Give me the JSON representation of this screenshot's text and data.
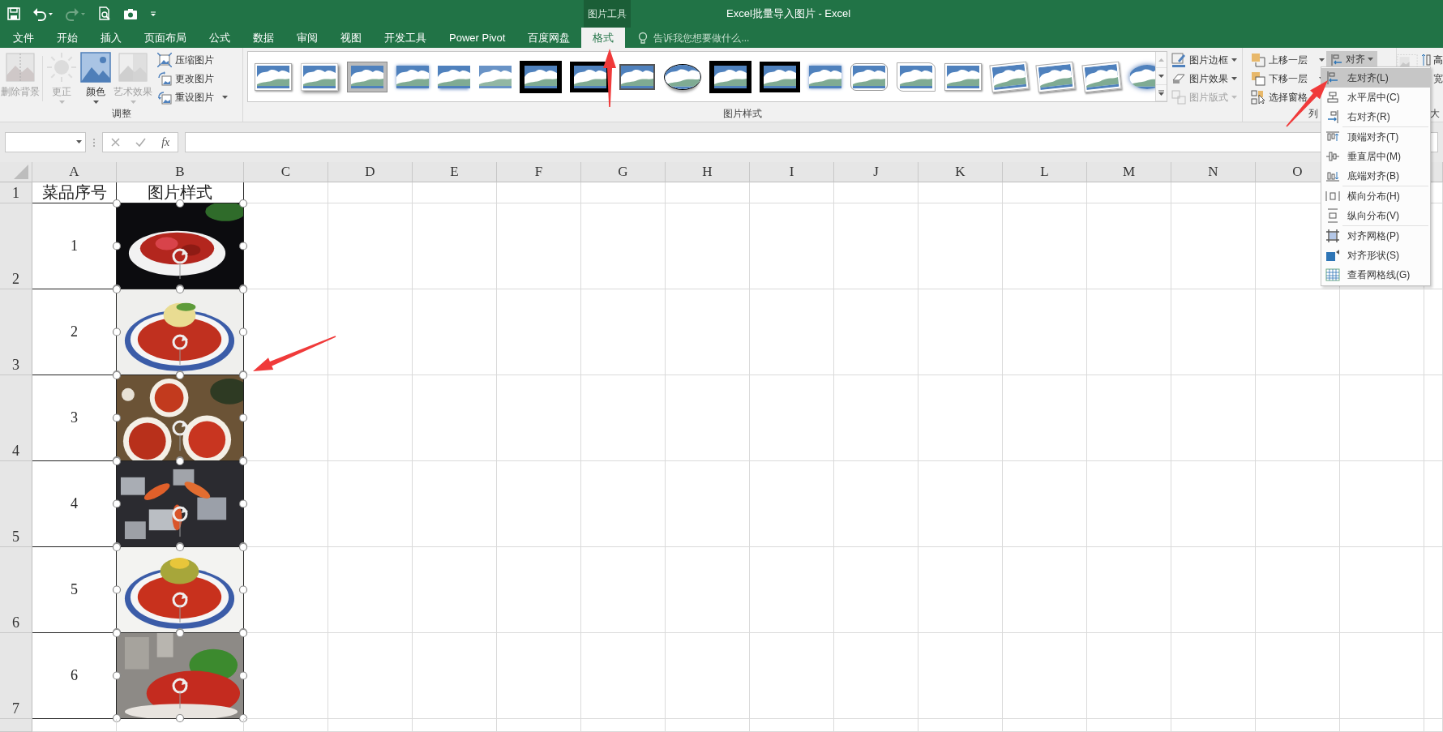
{
  "quick_access": [
    {
      "kind": "save",
      "disabled": false
    },
    {
      "kind": "undo",
      "disabled": false
    },
    {
      "kind": "redo",
      "disabled": true
    },
    {
      "kind": "print-preview",
      "disabled": false
    },
    {
      "kind": "camera",
      "disabled": false
    },
    {
      "kind": "customize",
      "disabled": false
    }
  ],
  "window": {
    "title": "Excel批量导入图片 - Excel",
    "context_label": "图片工具"
  },
  "tabs": [
    {
      "label": "文件",
      "selected": false
    },
    {
      "label": "开始",
      "selected": false
    },
    {
      "label": "插入",
      "selected": false
    },
    {
      "label": "页面布局",
      "selected": false
    },
    {
      "label": "公式",
      "selected": false
    },
    {
      "label": "数据",
      "selected": false
    },
    {
      "label": "审阅",
      "selected": false
    },
    {
      "label": "视图",
      "selected": false
    },
    {
      "label": "开发工具",
      "selected": false
    },
    {
      "label": "Power Pivot",
      "selected": false
    },
    {
      "label": "百度网盘",
      "selected": false
    },
    {
      "label": "格式",
      "selected": true
    }
  ],
  "tell_me": {
    "placeholder": "告诉我您想要做什么..."
  },
  "ribbon": {
    "adjust": {
      "label": "调整",
      "large_buttons": [
        {
          "label": "删除背景",
          "kind": "remove-background",
          "disabled": true,
          "dropdown": false
        },
        {
          "label": "更正",
          "kind": "corrections",
          "disabled": true,
          "dropdown": true
        },
        {
          "label": "颜色",
          "kind": "color",
          "disabled": false,
          "dropdown": true
        },
        {
          "label": "艺术效果",
          "kind": "artistic",
          "disabled": true,
          "dropdown": true
        }
      ],
      "small_buttons": [
        {
          "label": "压缩图片",
          "kind": "compress",
          "dropdown": false
        },
        {
          "label": "更改图片",
          "kind": "change",
          "dropdown": false
        },
        {
          "label": "重设图片",
          "kind": "reset",
          "dropdown": true
        }
      ]
    },
    "styles": {
      "label": "图片样式",
      "gallery": [
        {
          "kind": "frame"
        },
        {
          "kind": "shadow"
        },
        {
          "kind": "matte"
        },
        {
          "kind": "soft"
        },
        {
          "kind": "reflect"
        },
        {
          "kind": "fade"
        },
        {
          "kind": "double"
        },
        {
          "kind": "thick"
        },
        {
          "kind": "bevel"
        },
        {
          "kind": "oval"
        },
        {
          "kind": "double"
        },
        {
          "kind": "thick"
        },
        {
          "kind": "soft"
        },
        {
          "kind": "rounded"
        },
        {
          "kind": "snip"
        },
        {
          "kind": "frame"
        },
        {
          "kind": "tilt"
        },
        {
          "kind": "tilt"
        },
        {
          "kind": "tilt"
        },
        {
          "kind": "oval-soft"
        }
      ],
      "buttons": [
        {
          "label": "图片边框",
          "kind": "border",
          "disabled": false
        },
        {
          "label": "图片效果",
          "kind": "effects",
          "disabled": false
        },
        {
          "label": "图片版式",
          "kind": "layout",
          "disabled": true
        }
      ]
    },
    "arrange": {
      "label": "列",
      "buttons": [
        {
          "label": "上移一层",
          "kind": "forward"
        },
        {
          "label": "下移一层",
          "kind": "backward"
        },
        {
          "label": "选择窗格",
          "kind": "pane"
        }
      ],
      "align": {
        "label": "对齐",
        "pressed": true
      }
    },
    "size": {
      "label": "大",
      "fields": [
        "高",
        "宽"
      ]
    }
  },
  "formula_bar": {
    "function_label": "fx"
  },
  "sheet": {
    "columns": [
      "A",
      "B",
      "C",
      "D",
      "E",
      "F",
      "G",
      "H",
      "I",
      "J",
      "K",
      "L",
      "M",
      "N",
      "O"
    ],
    "header_row_number": "1",
    "header": [
      "菜品序号",
      "图片样式"
    ],
    "rows": [
      {
        "row_number": "2",
        "item": "1"
      },
      {
        "row_number": "3",
        "item": "2"
      },
      {
        "row_number": "4",
        "item": "3"
      },
      {
        "row_number": "5",
        "item": "4"
      },
      {
        "row_number": "6",
        "item": "5"
      },
      {
        "row_number": "7",
        "item": "6"
      }
    ]
  },
  "align_menu": {
    "sections": [
      [
        {
          "label": "左对齐(L)",
          "kind": "left",
          "selected": true
        },
        {
          "label": "水平居中(C)",
          "kind": "center",
          "selected": false
        },
        {
          "label": "右对齐(R)",
          "kind": "right",
          "selected": false
        }
      ],
      [
        {
          "label": "顶端对齐(T)",
          "kind": "top",
          "selected": false
        },
        {
          "label": "垂直居中(M)",
          "kind": "middle",
          "selected": false
        },
        {
          "label": "底端对齐(B)",
          "kind": "bottom",
          "selected": false
        }
      ],
      [
        {
          "label": "横向分布(H)",
          "kind": "distribute-h",
          "selected": false
        },
        {
          "label": "纵向分布(V)",
          "kind": "distribute-v",
          "selected": false
        }
      ],
      [
        {
          "label": "对齐网格(P)",
          "kind": "snap-grid",
          "selected": false
        },
        {
          "label": "对齐形状(S)",
          "kind": "snap-shape",
          "selected": false
        },
        {
          "label": "查看网格线(G)",
          "kind": "gridlines",
          "selected": false
        }
      ]
    ]
  }
}
